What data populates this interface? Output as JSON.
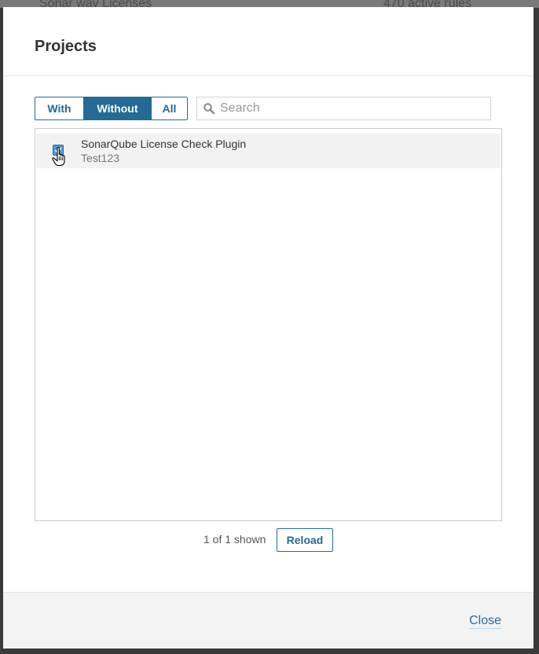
{
  "background": {
    "text_left": "Sonar way Licenses",
    "text_right": "470 active rules"
  },
  "modal": {
    "title": "Projects",
    "filters": [
      {
        "label": "With",
        "active": false
      },
      {
        "label": "Without",
        "active": true
      },
      {
        "label": "All",
        "active": false
      }
    ],
    "search": {
      "placeholder": "Search",
      "value": "",
      "icon": "search-icon"
    },
    "items": [
      {
        "title": "SonarQube License Check Plugin",
        "subtitle": "Test123",
        "checked": true
      }
    ],
    "count_text": "1 of 1 shown",
    "reload_label": "Reload",
    "close_label": "Close"
  },
  "colors": {
    "accent": "#236a97",
    "checkbox": "#4b9fd5",
    "row_highlight": "#f2f2f2",
    "footer_bg": "#f3f3f3"
  }
}
